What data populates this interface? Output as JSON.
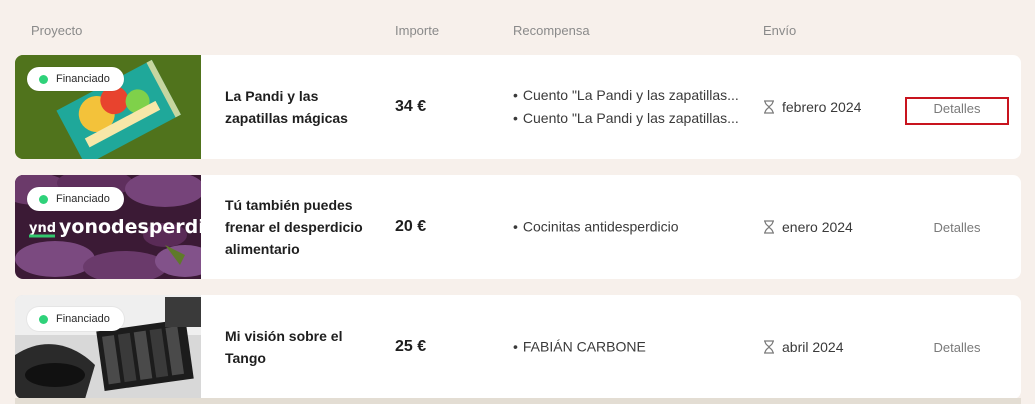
{
  "header": {
    "proyecto": "Proyecto",
    "importe": "Importe",
    "recompensa": "Recompensa",
    "envio": "Envío"
  },
  "badge_dot_color": "#2fd27a",
  "highlight_color": "#c8141e",
  "rows": [
    {
      "badge": "Financiado",
      "thumb_logo": "",
      "title": "La Pandi y las zapatillas mágicas",
      "amount": "34 €",
      "rewards": [
        "Cuento \"La Pandi y las zapatillas...",
        "Cuento \"La Pandi y las zapatillas..."
      ],
      "shipping": "febrero 2024",
      "details": "Detalles",
      "image_icon": "book-cover-image"
    },
    {
      "badge": "Financiado",
      "thumb_logo": "yonodesperdicio",
      "thumb_logo_short": "ynd",
      "title": "Tú también puedes frenar el desperdicio alimentario",
      "amount": "20 €",
      "rewards": [
        "Cocinitas antidesperdicio"
      ],
      "shipping": "enero 2024",
      "details": "Detalles",
      "image_icon": "eggplants-image"
    },
    {
      "badge": "Financiado",
      "thumb_logo": "",
      "title": "Mi visión sobre el Tango",
      "amount": "25 €",
      "rewards": [
        "FABIÁN CARBONE"
      ],
      "shipping": "abril 2024",
      "details": "Detalles",
      "image_icon": "bandoneon-photo-image"
    }
  ]
}
